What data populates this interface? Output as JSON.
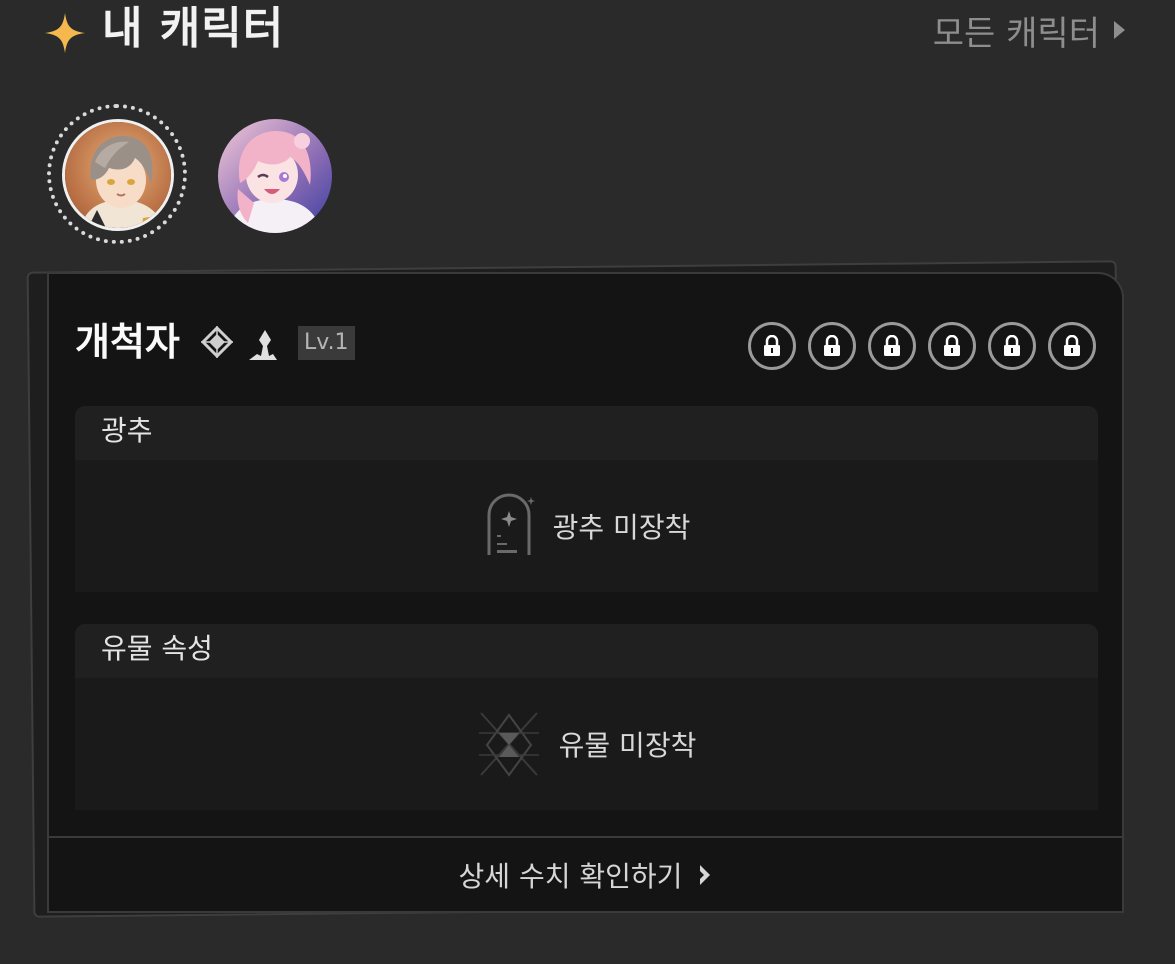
{
  "header": {
    "title": "내 캐릭터",
    "all_link": "모든 캐릭터",
    "star_color": "#f5b84f"
  },
  "avatars": [
    {
      "name": "avatar-1",
      "selected": true
    },
    {
      "name": "avatar-2",
      "selected": false
    }
  ],
  "character": {
    "name": "개척자",
    "level": "Lv.1",
    "eidolon_count": 6,
    "eidolons_locked": true
  },
  "light_cone": {
    "title": "광추",
    "empty_label": "광추 미장착"
  },
  "relics": {
    "title": "유물 속성",
    "empty_label": "유물 미장착"
  },
  "footer": {
    "details_label": "상세 수치 확인하기"
  }
}
